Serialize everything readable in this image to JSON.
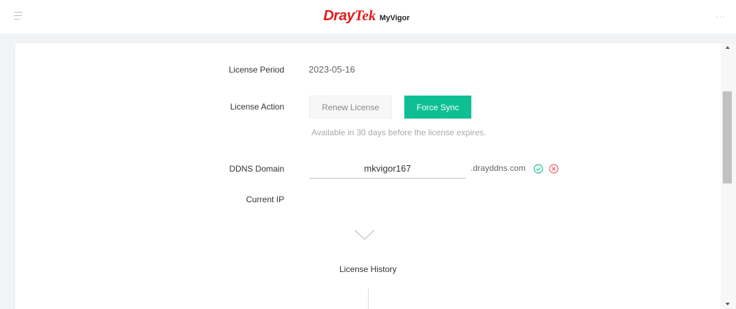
{
  "header": {
    "brand_dray": "Dray",
    "brand_tek": "Tek",
    "brand_product": "MyVigor",
    "more_label": "···"
  },
  "license": {
    "period_label": "License Period",
    "period_value": "2023-05-16",
    "action_label": "License Action",
    "renew_button": "Renew License",
    "force_sync_button": "Force Sync",
    "hint": "Available in 30 days before the license expires."
  },
  "ddns": {
    "label": "DDNS Domain",
    "value": "mkvigor167",
    "suffix": ".drayddns.com"
  },
  "current_ip": {
    "label": "Current IP",
    "value": ""
  },
  "history": {
    "title": "License History"
  },
  "colors": {
    "brand_red": "#e31b1b",
    "accent_green": "#0fbf94",
    "cancel_red": "#f05a5a"
  },
  "icons": [
    "menu-icon",
    "more-icon",
    "check-circle-icon",
    "close-circle-icon",
    "chevron-down-icon"
  ]
}
